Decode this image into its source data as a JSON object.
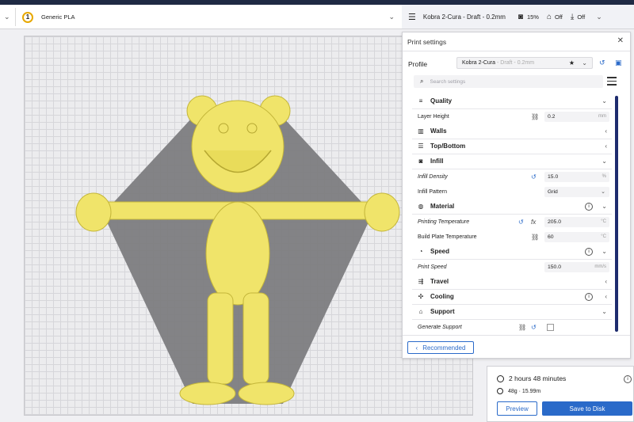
{
  "toolbar": {
    "extruder_number": "1",
    "material": "Generic PLA",
    "printer_profile": "Kobra 2-Cura - Draft - 0.2mm",
    "infill_value": "15%",
    "support_value": "Off",
    "adhesion_value": "Off"
  },
  "panel": {
    "title": "Print settings",
    "profile_label": "Profile",
    "profile_name": "Kobra 2-Cura",
    "profile_suffix": " - Draft - 0.2mm",
    "search_placeholder": "Search settings",
    "recommended_label": "Recommended"
  },
  "settings": {
    "quality": "Quality",
    "layer_height_label": "Layer Height",
    "layer_height_value": "0.2",
    "layer_height_unit": "mm",
    "walls": "Walls",
    "top_bottom": "Top/Bottom",
    "infill": "Infill",
    "infill_density_label": "Infill Density",
    "infill_density_value": "15.0",
    "infill_density_unit": "%",
    "infill_pattern_label": "Infill Pattern",
    "infill_pattern_value": "Grid",
    "material": "Material",
    "print_temp_label": "Printing Temperature",
    "print_temp_value": "205.0",
    "print_temp_unit": "°C",
    "bed_temp_label": "Build Plate Temperature",
    "bed_temp_value": "60",
    "bed_temp_unit": "°C",
    "speed": "Speed",
    "print_speed_label": "Print Speed",
    "print_speed_value": "150.0",
    "print_speed_unit": "mm/s",
    "travel": "Travel",
    "cooling": "Cooling",
    "support": "Support",
    "generate_support_label": "Generate Support"
  },
  "estimate": {
    "time": "2 hours 48 minutes",
    "material": "48g · 15.99m",
    "preview_label": "Preview",
    "save_label": "Save to Disk"
  },
  "colors": {
    "accent": "#2a6ac9",
    "model": "#f0e46a",
    "shadow": "#7d7d80"
  }
}
